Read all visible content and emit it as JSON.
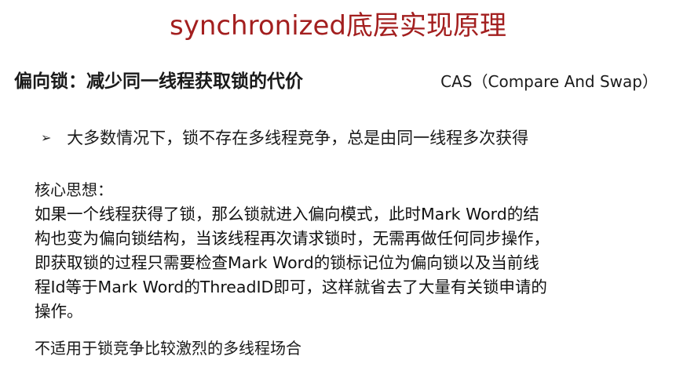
{
  "title": "synchronized底层实现原理",
  "heading": "偏向锁：减少同一线程获取锁的代价",
  "cas_note": "CAS（Compare And Swap）",
  "bullet": {
    "icon": "arrow-bullet-icon",
    "glyph": "➢",
    "text": "大多数情况下，锁不存在多线程竞争，总是由同一线程多次获得"
  },
  "core_label": "核心思想：",
  "core_lines": [
    "如果一个线程获得了锁，那么锁就进入偏向模式，此时Mark Word的结",
    "构也变为偏向锁结构，当该线程再次请求锁时，无需再做任何同步操作，",
    "即获取锁的过程只需要检查Mark Word的锁标记位为偏向锁以及当前线",
    "程Id等于Mark Word的ThreadID即可，这样就省去了大量有关锁申请的",
    "操作。"
  ],
  "note": "不适用于锁竞争比较激烈的多线程场合",
  "colors": {
    "title": "#a31f1f",
    "text": "#111111",
    "background": "#ffffff"
  }
}
